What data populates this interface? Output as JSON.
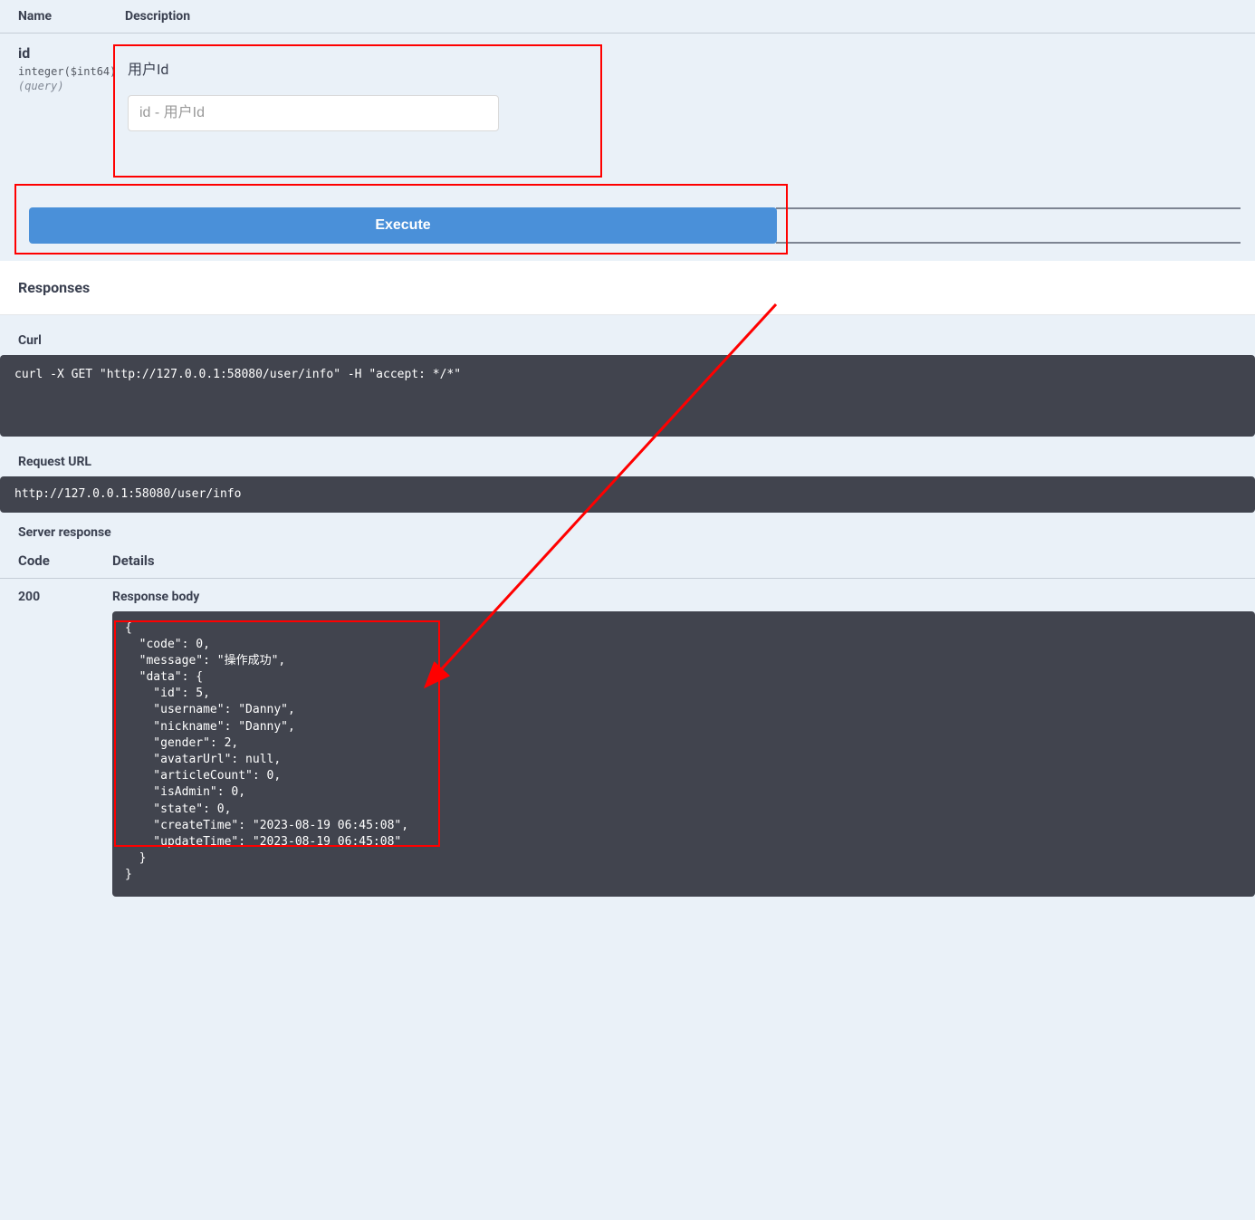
{
  "params": {
    "header_name": "Name",
    "header_desc": "Description",
    "item": {
      "name": "id",
      "type": "integer($int64)",
      "in": "(query)",
      "desc": "用户Id",
      "placeholder": "id - 用户Id"
    }
  },
  "buttons": {
    "execute": "Execute"
  },
  "responses": {
    "header": "Responses",
    "curl_label": "Curl",
    "curl_cmd": "curl -X GET \"http://127.0.0.1:58080/user/info\" -H \"accept: */*\"",
    "url_label": "Request URL",
    "url_value": "http://127.0.0.1:58080/user/info",
    "server_label": "Server response",
    "code_label": "Code",
    "details_label": "Details",
    "code_value": "200",
    "body_label": "Response body",
    "body_json": "{\n  \"code\": 0,\n  \"message\": \"操作成功\",\n  \"data\": {\n    \"id\": 5,\n    \"username\": \"Danny\",\n    \"nickname\": \"Danny\",\n    \"gender\": 2,\n    \"avatarUrl\": null,\n    \"articleCount\": 0,\n    \"isAdmin\": 0,\n    \"state\": 0,\n    \"createTime\": \"2023-08-19 06:45:08\",\n    \"updateTime\": \"2023-08-19 06:45:08\"\n  }\n}"
  }
}
